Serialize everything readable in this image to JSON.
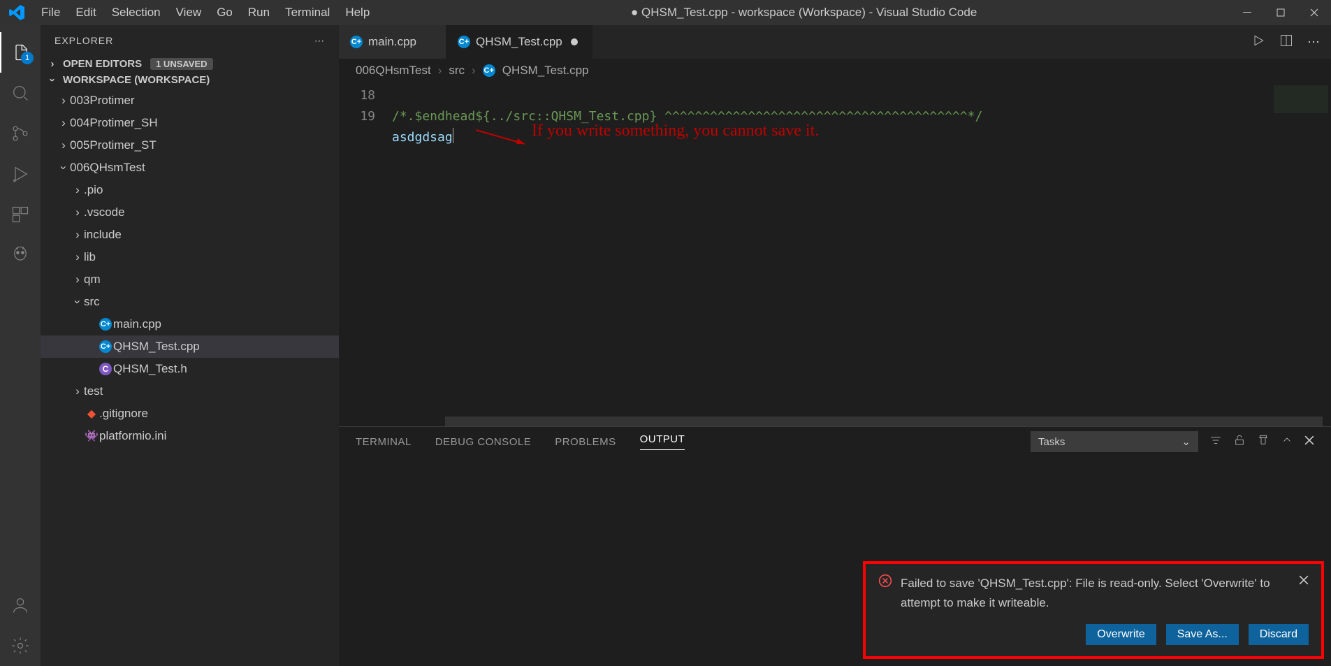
{
  "title_prefix_dot": "●",
  "title": "QHSM_Test.cpp - workspace (Workspace) - Visual Studio Code",
  "menus": [
    "File",
    "Edit",
    "Selection",
    "View",
    "Go",
    "Run",
    "Terminal",
    "Help"
  ],
  "explorer_title": "EXPLORER",
  "open_editors_label": "OPEN EDITORS",
  "unsaved_badge": "1 UNSAVED",
  "workspace_label": "WORKSPACE (WORKSPACE)",
  "tree": {
    "items": [
      {
        "depth": 0,
        "chevron": "right",
        "label": "003Protimer"
      },
      {
        "depth": 0,
        "chevron": "right",
        "label": "004Protimer_SH"
      },
      {
        "depth": 0,
        "chevron": "right",
        "label": "005Protimer_ST"
      },
      {
        "depth": 0,
        "chevron": "down",
        "label": "006QHsmTest"
      },
      {
        "depth": 1,
        "chevron": "right",
        "label": ".pio"
      },
      {
        "depth": 1,
        "chevron": "right",
        "label": ".vscode"
      },
      {
        "depth": 1,
        "chevron": "right",
        "label": "include"
      },
      {
        "depth": 1,
        "chevron": "right",
        "label": "lib"
      },
      {
        "depth": 1,
        "chevron": "right",
        "label": "qm"
      },
      {
        "depth": 1,
        "chevron": "down",
        "label": "src"
      },
      {
        "depth": 2,
        "chevron": "",
        "icon": "cpp",
        "label": "main.cpp"
      },
      {
        "depth": 2,
        "chevron": "",
        "icon": "cpp",
        "label": "QHSM_Test.cpp",
        "selected": true
      },
      {
        "depth": 2,
        "chevron": "",
        "icon": "c",
        "label": "QHSM_Test.h"
      },
      {
        "depth": 1,
        "chevron": "right",
        "label": "test"
      },
      {
        "depth": 1,
        "chevron": "",
        "icon": "git",
        "label": ".gitignore"
      },
      {
        "depth": 1,
        "chevron": "",
        "icon": "pio",
        "label": "platformio.ini"
      }
    ]
  },
  "tabs": [
    {
      "icon": "cpp",
      "label": "main.cpp",
      "dirty": false,
      "active": false
    },
    {
      "icon": "cpp",
      "label": "QHSM_Test.cpp",
      "dirty": true,
      "active": true
    }
  ],
  "breadcrumbs": [
    "006QHsmTest",
    "src",
    "QHSM_Test.cpp"
  ],
  "editor": {
    "line18_no": "18",
    "line19_no": "19",
    "line18_text": "/*.$endhead${../src::QHSM_Test.cpp} ^^^^^^^^^^^^^^^^^^^^^^^^^^^^^^^^^^^^^^^^*/",
    "line19_text": "asdgdsag"
  },
  "annotation_text": "If you write something, you cannot save it.",
  "panel": {
    "tabs": [
      "TERMINAL",
      "DEBUG CONSOLE",
      "PROBLEMS",
      "OUTPUT"
    ],
    "active": "OUTPUT",
    "select": "Tasks"
  },
  "notification": {
    "message": "Failed to save 'QHSM_Test.cpp': File is read-only. Select 'Overwrite' to attempt to make it writeable.",
    "buttons": [
      "Overwrite",
      "Save As...",
      "Discard"
    ]
  },
  "activity_badge": "1"
}
